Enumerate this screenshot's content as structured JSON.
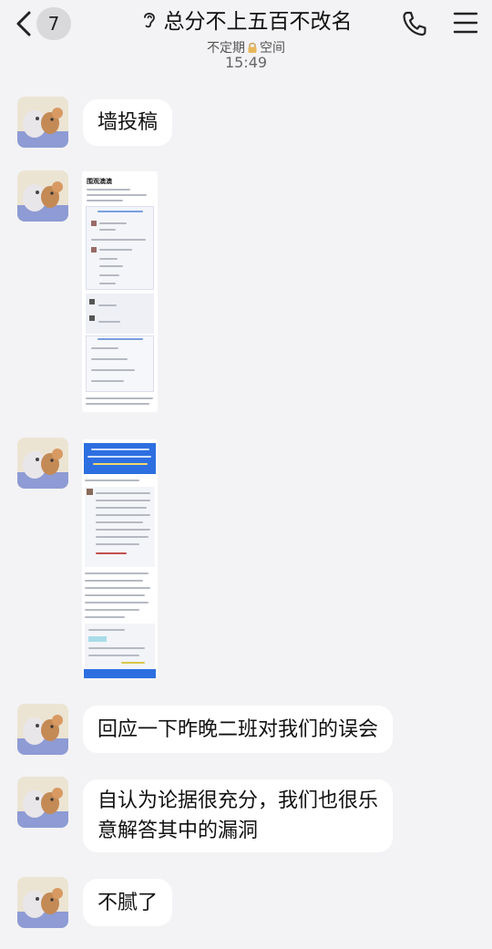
{
  "header": {
    "back_count": "7",
    "title": "总分不上五百不改名",
    "subtitle_left": "不定期",
    "subtitle_right": "空间",
    "back_icon": "chevron-left-icon",
    "ear_icon": "ear-icon",
    "lock_icon": "lock-icon",
    "phone_icon": "phone-icon",
    "menu_icon": "menu-icon"
  },
  "time": "15:49",
  "messages": [
    {
      "type": "text",
      "text": "墙投稿"
    },
    {
      "type": "image",
      "image_title": "围观澳澳"
    },
    {
      "type": "image"
    },
    {
      "type": "text",
      "text": "回应一下昨晚二班对我们的误会"
    },
    {
      "type": "text",
      "line1": "自认为论据很充分，我们也很乐",
      "line2": "意解答其中的漏洞"
    },
    {
      "type": "text",
      "text": "不腻了"
    }
  ],
  "colors": {
    "background": "#f3f3f5",
    "bubble": "#ffffff",
    "screenshot_blue": "#2d6fe0"
  }
}
